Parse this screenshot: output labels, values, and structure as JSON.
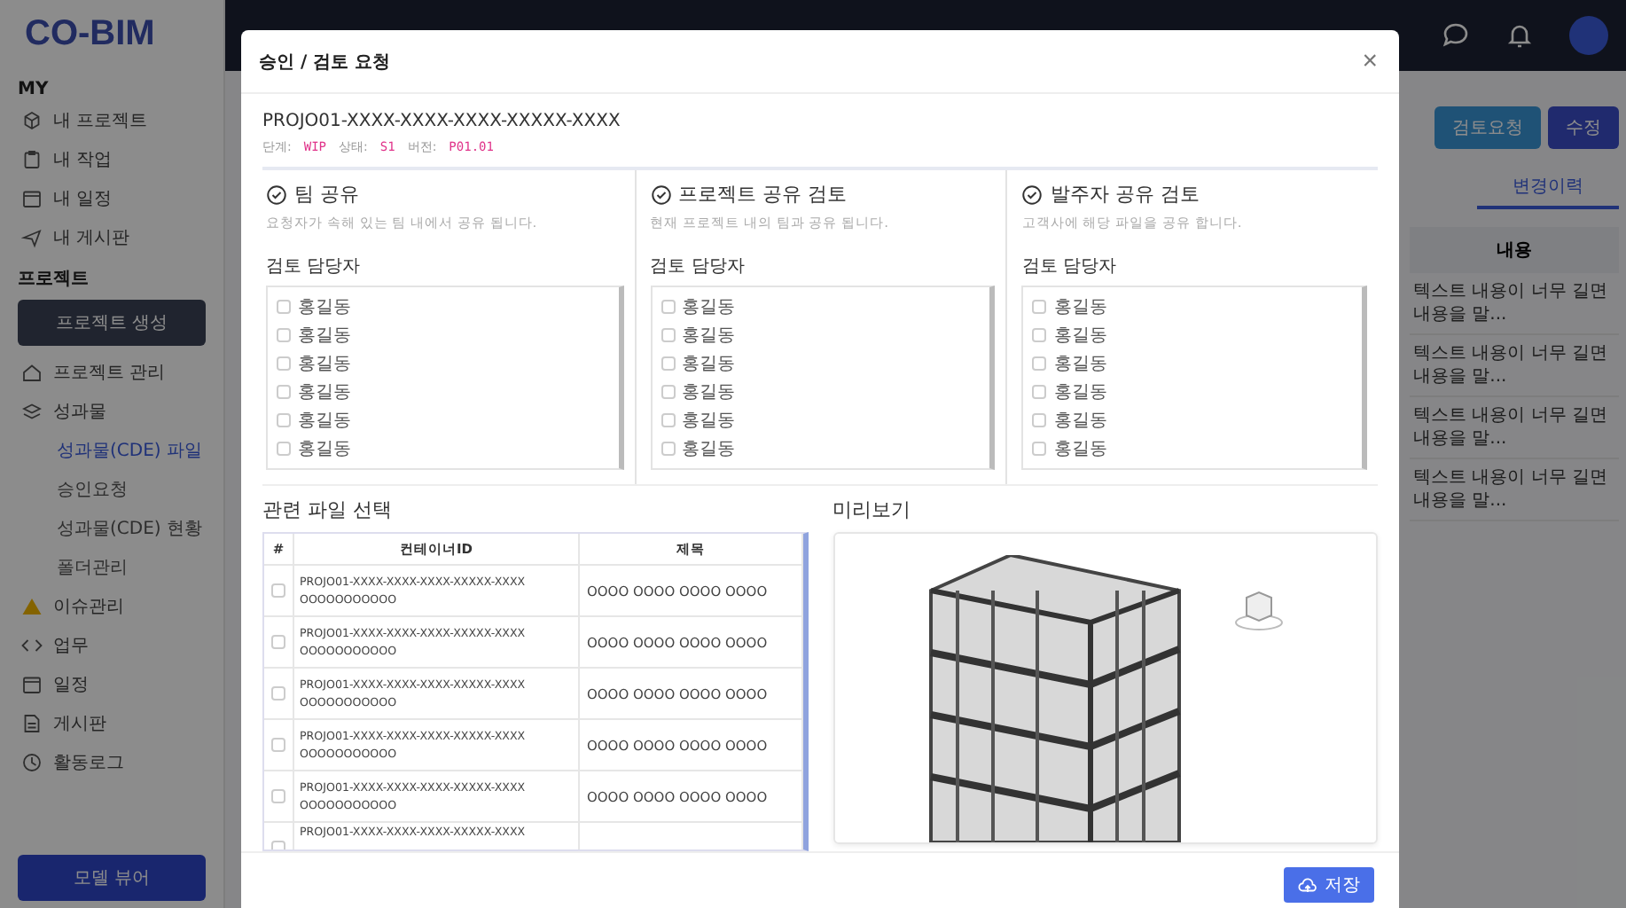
{
  "app": {
    "logo": "CO-BIM"
  },
  "sidebar": {
    "sections": [
      {
        "heading": "MY",
        "items": [
          {
            "label": "내 프로젝트"
          },
          {
            "label": "내 작업"
          },
          {
            "label": "내 일정"
          },
          {
            "label": "내 게시판"
          }
        ]
      },
      {
        "heading": "프로젝트"
      }
    ],
    "create_button": "프로젝트 생성",
    "nav": [
      {
        "label": "프로젝트 관리"
      },
      {
        "label": "성과물",
        "children": [
          {
            "label": "성과물(CDE) 파일",
            "selected": true
          },
          {
            "label": "승인요청",
            "selected": false
          },
          {
            "label": "성과물(CDE) 현황",
            "selected": false
          },
          {
            "label": "폴더관리",
            "selected": false
          }
        ]
      },
      {
        "label": "이슈관리"
      },
      {
        "label": "업무"
      },
      {
        "label": "일정"
      },
      {
        "label": "게시판"
      },
      {
        "label": "활동로그"
      }
    ],
    "viewer_button": "모델 뷰어"
  },
  "background": {
    "buttons": [
      "검토요청",
      "수정"
    ],
    "tab": "변경이력",
    "column": "내용",
    "rows": [
      "텍스트 내용이 너무 길면 내용을 말...",
      "텍스트 내용이 너무 길면 내용을 말...",
      "텍스트 내용이 너무 길면 내용을 말...",
      "텍스트 내용이 너무 길면 내용을 말..."
    ]
  },
  "modal": {
    "title": "승인 / 검토 요청",
    "close": "×",
    "file_id": "PROJO01-XXXX-XXXX-XXXX-XXXXX-XXXX",
    "meta": [
      {
        "label": "단계:",
        "value": "WIP"
      },
      {
        "label": "상태:",
        "value": "S1"
      },
      {
        "label": "버전:",
        "value": "P01.01"
      }
    ],
    "options": [
      {
        "title": "팀 공유",
        "description": "요청자가 속해 있는 팀 내에서 공유 됩니다.",
        "reviewer_label": "검토 담당자",
        "reviewers": [
          {
            "name": "홍길동",
            "checked": false
          },
          {
            "name": "홍길동",
            "checked": false
          },
          {
            "name": "홍길동",
            "checked": false
          },
          {
            "name": "홍길동",
            "checked": false
          },
          {
            "name": "홍길동",
            "checked": false
          },
          {
            "name": "홍길동",
            "checked": false
          }
        ]
      },
      {
        "title": "프로젝트 공유 검토",
        "description": "현재 프로젝트 내의 팀과 공유 됩니다.",
        "reviewer_label": "검토 담당자",
        "reviewers": [
          {
            "name": "홍길동",
            "checked": false
          },
          {
            "name": "홍길동",
            "checked": false
          },
          {
            "name": "홍길동",
            "checked": false
          },
          {
            "name": "홍길동",
            "checked": false
          },
          {
            "name": "홍길동",
            "checked": false
          },
          {
            "name": "홍길동",
            "checked": false
          }
        ]
      },
      {
        "title": "발주자 공유 검토",
        "description": "고객사에 해당 파일을 공유 합니다.",
        "reviewer_label": "검토 담당자",
        "reviewers": [
          {
            "name": "홍길동",
            "checked": false
          },
          {
            "name": "홍길동",
            "checked": false
          },
          {
            "name": "홍길동",
            "checked": false
          },
          {
            "name": "홍길동",
            "checked": false
          },
          {
            "name": "홍길동",
            "checked": false
          },
          {
            "name": "홍길동",
            "checked": false
          }
        ]
      }
    ],
    "files": {
      "title": "관련 파일 선택",
      "columns": [
        "#",
        "컨테이너ID",
        "제목"
      ],
      "rows": [
        {
          "checked": false,
          "id": "PROJO01-XXXX-XXXX-XXXX-XXXXX-XXXX",
          "id_suffix": "OOOOOOOOOOO",
          "title": "OOOO OOOO OOOO OOOO"
        },
        {
          "checked": false,
          "id": "PROJO01-XXXX-XXXX-XXXX-XXXXX-XXXX",
          "id_suffix": "OOOOOOOOOOO",
          "title": "OOOO OOOO OOOO OOOO"
        },
        {
          "checked": false,
          "id": "PROJO01-XXXX-XXXX-XXXX-XXXXX-XXXX",
          "id_suffix": "OOOOOOOOOOO",
          "title": "OOOO OOOO OOOO OOOO"
        },
        {
          "checked": false,
          "id": "PROJO01-XXXX-XXXX-XXXX-XXXXX-XXXX",
          "id_suffix": "OOOOOOOOOOO",
          "title": "OOOO OOOO OOOO OOOO"
        },
        {
          "checked": false,
          "id": "PROJO01-XXXX-XXXX-XXXX-XXXXX-XXXX",
          "id_suffix": "OOOOOOOOOOO",
          "title": "OOOO OOOO OOOO OOOO"
        },
        {
          "checked": false,
          "id": "PROJO01-XXXX-XXXX-XXXX-XXXXX-XXXX"
        }
      ]
    },
    "preview": {
      "title": "미리보기"
    },
    "save_button": "저장"
  }
}
